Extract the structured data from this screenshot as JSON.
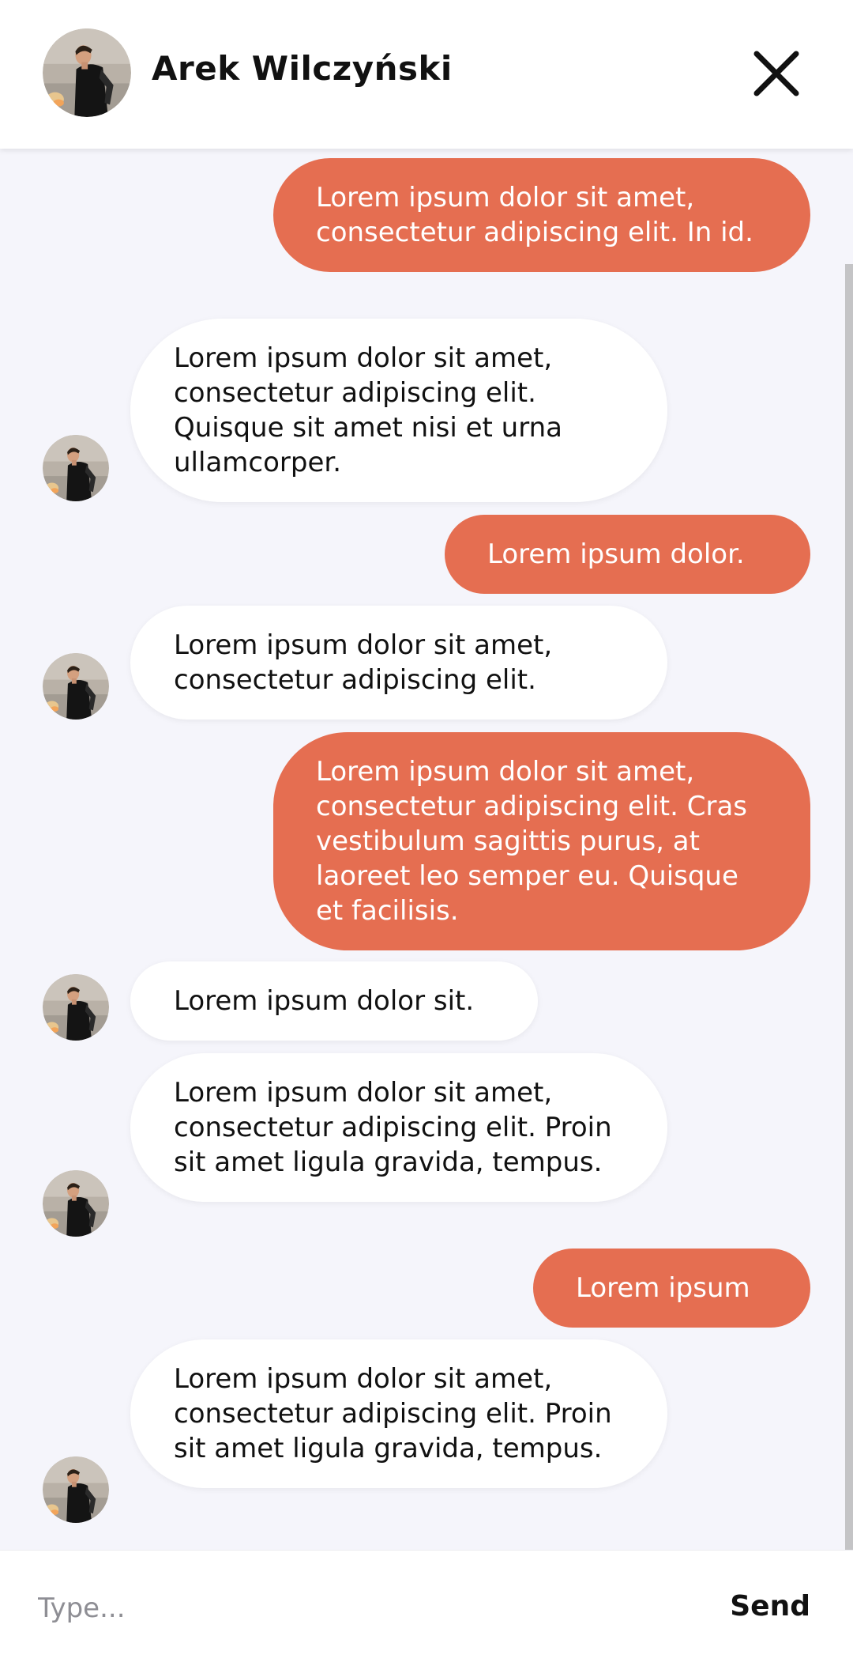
{
  "header": {
    "contact_name": "Arek Wilczyński",
    "close_icon": "close-icon"
  },
  "messages": [
    {
      "direction": "out",
      "text": "Lorem ipsum dolor sit amet, consectetur adipiscing elit. In id."
    },
    {
      "direction": "in",
      "text": "Lorem ipsum dolor sit amet, consectetur adipiscing elit. Quisque sit amet nisi et urna ullamcorper."
    },
    {
      "direction": "out",
      "text": "Lorem ipsum dolor."
    },
    {
      "direction": "in",
      "text": "Lorem ipsum dolor sit amet, consectetur adipiscing elit."
    },
    {
      "direction": "out",
      "text": "Lorem ipsum dolor sit amet, consectetur adipiscing elit. Cras vestibulum sagittis purus, at laoreet leo semper eu. Quisque et facilisis."
    },
    {
      "direction": "in",
      "text": "Lorem ipsum dolor sit."
    },
    {
      "direction": "in",
      "text": "Lorem ipsum dolor sit amet, consectetur adipiscing elit. Proin sit amet ligula gravida, tempus."
    },
    {
      "direction": "out",
      "text": "Lorem ipsum"
    },
    {
      "direction": "in",
      "text": "Lorem ipsum dolor sit amet, consectetur adipiscing elit. Proin sit amet ligula gravida, tempus."
    }
  ],
  "composer": {
    "placeholder": "Type...",
    "send_label": "Send"
  },
  "colors": {
    "outgoing_bubble": "#e56e51",
    "incoming_bubble": "#ffffff",
    "background": "#f5f5fb"
  }
}
